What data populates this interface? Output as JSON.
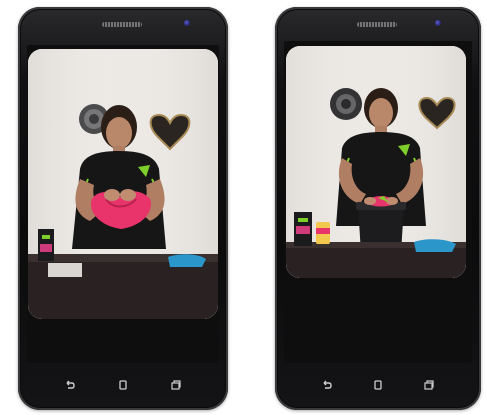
{
  "phones": [
    {
      "id": "left",
      "video": {
        "scene": "presenter-folding-pink-fabric"
      },
      "nav": [
        {
          "icon": "back-icon",
          "label": ""
        },
        {
          "icon": "home-icon",
          "label": ""
        },
        {
          "icon": "recent-apps-icon",
          "label": ""
        }
      ]
    },
    {
      "id": "right",
      "video": {
        "scene": "presenter-placing-pink-fabric-into-black-container"
      },
      "nav": [
        {
          "icon": "back-icon",
          "label": ""
        },
        {
          "icon": "home-icon",
          "label": ""
        },
        {
          "icon": "recent-apps-icon",
          "label": ""
        }
      ]
    }
  ],
  "colors": {
    "phone_body": "#111113",
    "nav_icon": "#cfcfd2",
    "wall": "#ece9e6",
    "shirt": "#151515",
    "accent_green": "#7fcf2a",
    "pink": "#e8336b",
    "teal": "#2b96c9"
  }
}
